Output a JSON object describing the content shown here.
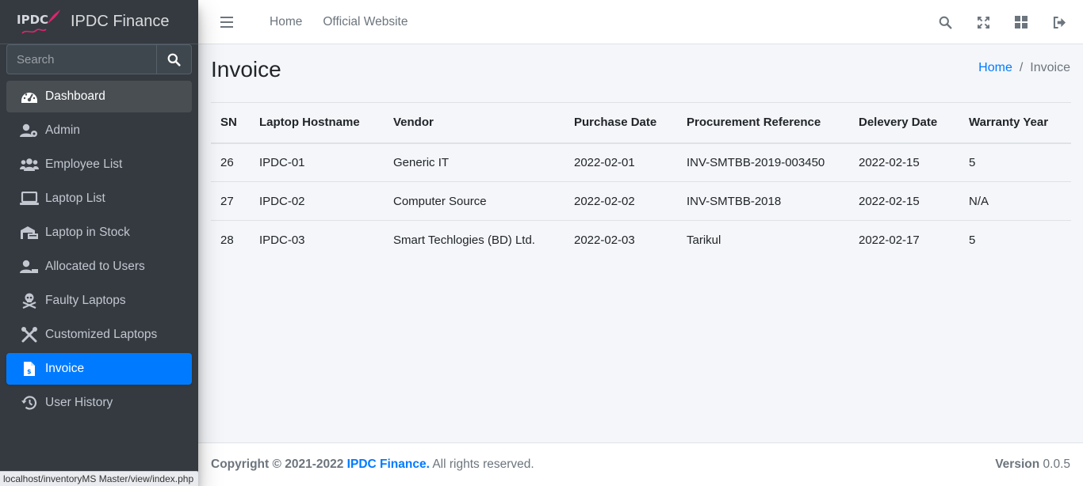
{
  "brand": {
    "logo_text": "IPDC",
    "name": "IPDC Finance"
  },
  "sidebar": {
    "search_placeholder": "Search",
    "items": [
      {
        "label": "Dashboard",
        "icon": "tachometer-icon",
        "state": "hover"
      },
      {
        "label": "Admin",
        "icon": "user-cog-icon",
        "state": ""
      },
      {
        "label": "Employee List",
        "icon": "users-icon",
        "state": ""
      },
      {
        "label": "Laptop List",
        "icon": "laptop-icon",
        "state": ""
      },
      {
        "label": "Laptop in Stock",
        "icon": "warehouse-icon",
        "state": ""
      },
      {
        "label": "Allocated to Users",
        "icon": "user-check-icon",
        "state": ""
      },
      {
        "label": "Faulty Laptops",
        "icon": "skull-crossbones-icon",
        "state": ""
      },
      {
        "label": "Customized Laptops",
        "icon": "tools-icon",
        "state": ""
      },
      {
        "label": "Invoice",
        "icon": "file-invoice-icon",
        "state": "active"
      },
      {
        "label": "User History",
        "icon": "history-icon",
        "state": ""
      }
    ]
  },
  "topbar": {
    "links": [
      "Home",
      "Official Website"
    ],
    "icons": [
      "search-icon",
      "expand-icon",
      "grid-icon",
      "sign-out-icon"
    ]
  },
  "page": {
    "title": "Invoice",
    "breadcrumb": {
      "home": "Home",
      "separator": "/",
      "current": "Invoice"
    }
  },
  "table": {
    "headers": [
      "SN",
      "Laptop Hostname",
      "Vendor",
      "Purchase Date",
      "Procurement Reference",
      "Delevery Date",
      "Warranty Year"
    ],
    "rows": [
      [
        "26",
        "IPDC-01",
        "Generic IT",
        "2022-02-01",
        "INV-SMTBB-2019-003450",
        "2022-02-15",
        "5"
      ],
      [
        "27",
        "IPDC-02",
        "Computer Source",
        "2022-02-02",
        "INV-SMTBB-2018",
        "2022-02-15",
        "N/A"
      ],
      [
        "28",
        "IPDC-03",
        "Smart Techlogies (BD) Ltd.",
        "2022-02-03",
        "Tarikul",
        "2022-02-17",
        "5"
      ]
    ]
  },
  "footer": {
    "copyright_prefix": "Copyright © 2021-2022",
    "brand_link": "IPDC Finance.",
    "rights": "All rights reserved.",
    "version_label": "Version",
    "version_value": "0.0.5"
  },
  "statusbar": {
    "url": "localhost/inventoryMS Master/view/index.php"
  },
  "colors": {
    "sidebar_bg": "#343a40",
    "active": "#007bff",
    "link": "#007bff",
    "content_bg": "#f4f6f9"
  }
}
